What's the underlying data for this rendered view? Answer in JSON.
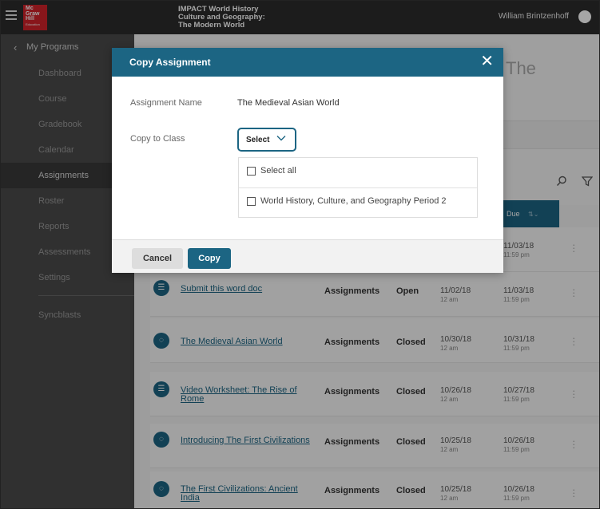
{
  "header": {
    "logo_lines": [
      "Mc",
      "Graw",
      "Hill"
    ],
    "logo_sub": "Education",
    "product_title_lines": [
      "IMPACT World History",
      "Culture and Geography:",
      "The Modern World"
    ],
    "user_name": "William Brintzenhoff"
  },
  "sidebar": {
    "back_label": "My Programs",
    "items": [
      {
        "label": "Dashboard"
      },
      {
        "label": "Course"
      },
      {
        "label": "Gradebook"
      },
      {
        "label": "Calendar"
      },
      {
        "label": "Assignments"
      },
      {
        "label": "Roster"
      },
      {
        "label": "Reports"
      },
      {
        "label": "Assessments"
      },
      {
        "label": "Settings"
      },
      {
        "label": "Syncblasts"
      }
    ]
  },
  "main": {
    "heading_fragment": "The",
    "due_header": "Due",
    "rows": [
      {
        "title": "",
        "category": "",
        "status": "",
        "assign_date": "",
        "assign_time": "",
        "due_date": "11/03/18",
        "due_time": "11:59 pm"
      },
      {
        "title": "Submit this word doc",
        "category": "Assignments",
        "status": "Open",
        "assign_date": "11/02/18",
        "assign_time": "12 am",
        "due_date": "11/03/18",
        "due_time": "11:59 pm"
      },
      {
        "title": "The Medieval Asian World",
        "category": "Assignments",
        "status": "Closed",
        "assign_date": "10/30/18",
        "assign_time": "12 am",
        "due_date": "10/31/18",
        "due_time": "11:59 pm"
      },
      {
        "title": "Video Worksheet: The Rise of Rome",
        "category": "Assignments",
        "status": "Closed",
        "assign_date": "10/26/18",
        "assign_time": "12 am",
        "due_date": "10/27/18",
        "due_time": "11:59 pm"
      },
      {
        "title": "Introducing The First Civilizations",
        "category": "Assignments",
        "status": "Closed",
        "assign_date": "10/25/18",
        "assign_time": "12 am",
        "due_date": "10/26/18",
        "due_time": "11:59 pm"
      },
      {
        "title": "The First Civilizations: Ancient India",
        "category": "Assignments",
        "status": "Closed",
        "assign_date": "10/25/18",
        "assign_time": "12 am",
        "due_date": "10/26/18",
        "due_time": "11:59 pm"
      }
    ]
  },
  "modal": {
    "title": "Copy Assignment",
    "close_glyph": "✕",
    "assignment_name_label": "Assignment Name",
    "assignment_name_value": "The Medieval Asian World",
    "copy_to_class_label": "Copy to Class",
    "select_value": "Select",
    "options": [
      {
        "label": "Select all"
      },
      {
        "label": "World History, Culture, and Geography Period 2"
      }
    ],
    "cancel_label": "Cancel",
    "copy_label": "Copy"
  },
  "colors": {
    "accent": "#1c6583",
    "brand_red": "#d2232a",
    "topbar": "#2b2b2b",
    "sidebar": "#4b4b4b"
  }
}
